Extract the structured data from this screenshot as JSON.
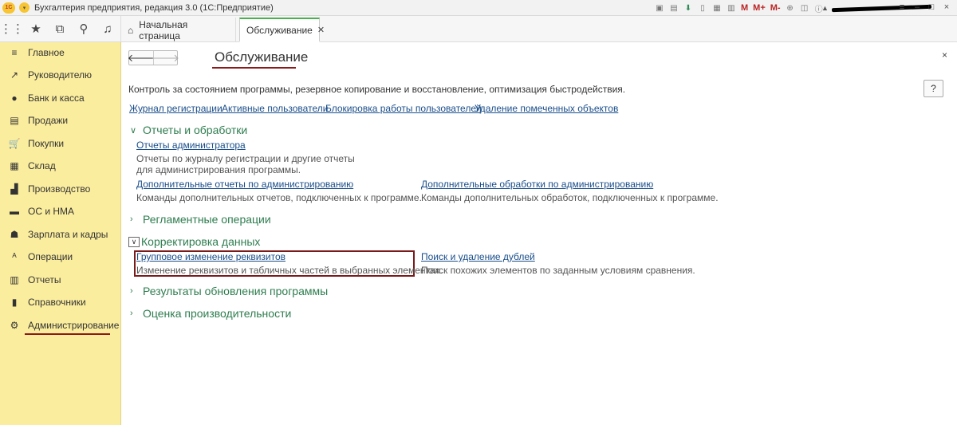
{
  "titlebar": {
    "logo": "1С",
    "title": "Бухгалтерия предприятия, редакция 3.0   (1С:Предприятие)",
    "tools": [
      "save-icon",
      "print-icon",
      "download-icon",
      "doc-icon",
      "calc-icon",
      "calendar-icon"
    ],
    "mem_labels": [
      "M",
      "M+",
      "M-"
    ],
    "user": "",
    "controls": [
      "≡",
      "–",
      "□",
      "×"
    ]
  },
  "toolbar": {
    "icons": [
      "apps-grid-icon",
      "star-icon",
      "history-icon",
      "search-icon",
      "bell-icon"
    ]
  },
  "tabs": {
    "home_label": "Начальная страница",
    "active_label": "Обслуживание"
  },
  "sidebar": {
    "items": [
      {
        "label": "Главное",
        "icon": "≡"
      },
      {
        "label": "Руководителю",
        "icon": "↗"
      },
      {
        "label": "Банк и касса",
        "icon": "●"
      },
      {
        "label": "Продажи",
        "icon": "▤"
      },
      {
        "label": "Покупки",
        "icon": "🛒"
      },
      {
        "label": "Склад",
        "icon": "▦"
      },
      {
        "label": "Производство",
        "icon": "▟"
      },
      {
        "label": "ОС и НМА",
        "icon": "▬"
      },
      {
        "label": "Зарплата и кадры",
        "icon": "☗"
      },
      {
        "label": "Операции",
        "icon": "ᴬ"
      },
      {
        "label": "Отчеты",
        "icon": "▥"
      },
      {
        "label": "Справочники",
        "icon": "▮"
      },
      {
        "label": "Администрирование",
        "icon": "⚙"
      }
    ]
  },
  "main": {
    "title": "Обслуживание",
    "description": "Контроль за состоянием программы, резервное копирование и восстановление, оптимизация быстродействия.",
    "help": "?",
    "close": "×",
    "top_links": [
      "Журнал регистрации",
      "Активные пользователи",
      "Блокировка работы пользователей",
      "Удаление помеченных объектов"
    ],
    "sections": {
      "reports": {
        "title": "Отчеты и обработки",
        "admin_reports_link": "Отчеты администратора",
        "admin_reports_note": "Отчеты по журналу регистрации и другие отчеты для администрирования программы.",
        "add_reports_link": "Дополнительные отчеты по администрированию",
        "add_reports_note": "Команды дополнительных отчетов, подключенных к программе.",
        "add_processing_link": "Дополнительные обработки по администрированию",
        "add_processing_note": "Команды дополнительных обработок, подключенных к программе."
      },
      "routine": {
        "title": "Регламентные операции"
      },
      "correction": {
        "title": "Корректировка данных",
        "group_change_link": "Групповое изменение реквизитов",
        "group_change_note": "Изменение реквизитов и табличных частей в выбранных элементах.",
        "duplicates_link": "Поиск и удаление дублей",
        "duplicates_note": "Поиск похожих элементов по заданным условиям сравнения."
      },
      "update_results": {
        "title": "Результаты обновления программы"
      },
      "performance": {
        "title": "Оценка производительности"
      }
    }
  }
}
